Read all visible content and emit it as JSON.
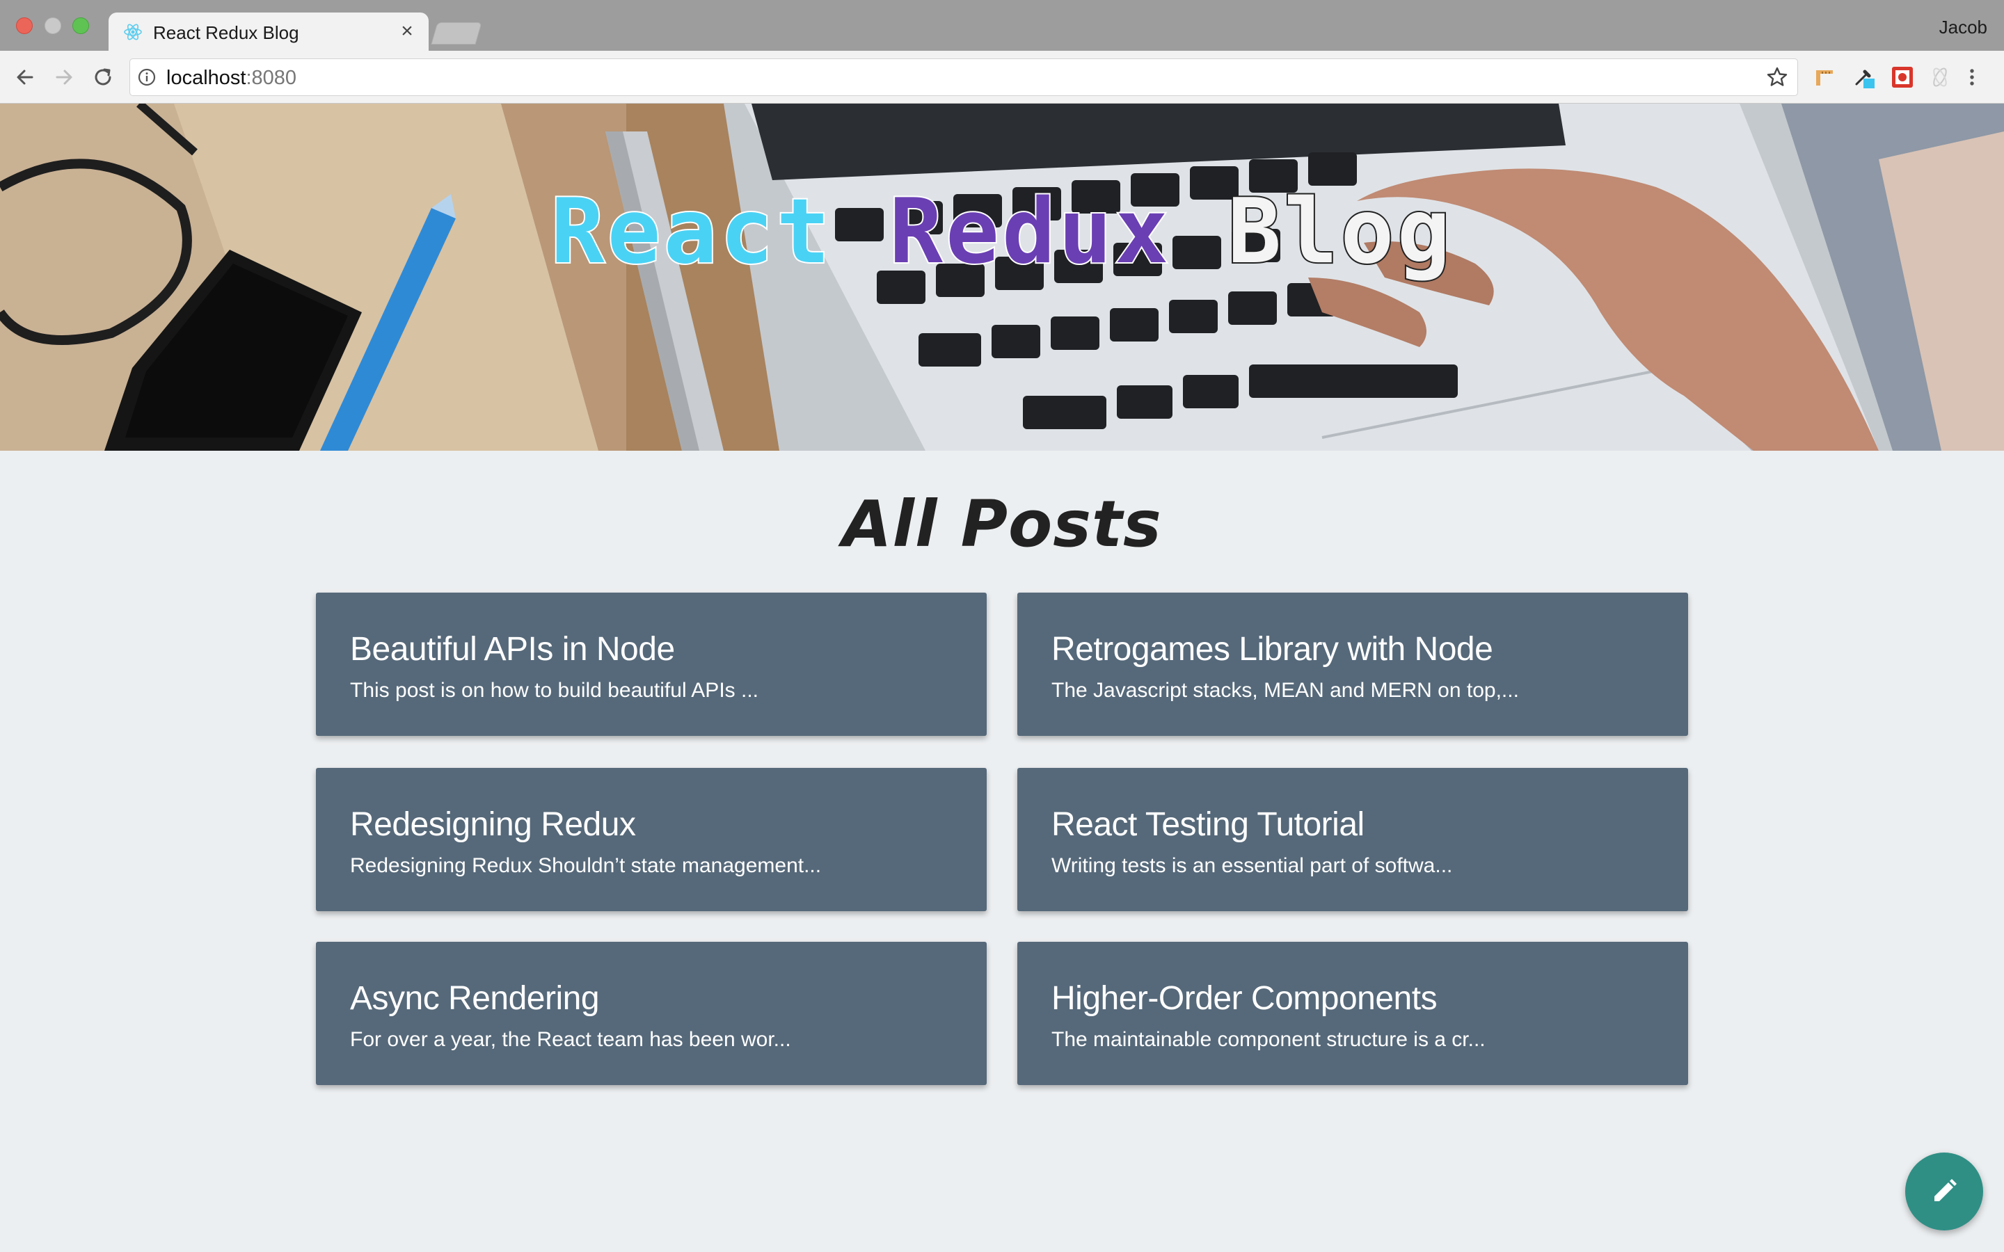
{
  "browser": {
    "tab_title": "React Redux Blog",
    "tab_close": "×",
    "profile_name": "Jacob",
    "url_host": "localhost",
    "url_port": ":8080"
  },
  "hero": {
    "title_word_1": "React",
    "title_word_2": "Redux",
    "title_word_3": "Blog"
  },
  "main": {
    "heading": "All Posts"
  },
  "posts": [
    {
      "title": "Beautiful APIs in Node",
      "excerpt": "This post is on how to build beautiful APIs ..."
    },
    {
      "title": "Retrogames Library with Node",
      "excerpt": "The Javascript stacks, MEAN and MERN on top,..."
    },
    {
      "title": "Redesigning Redux",
      "excerpt": "Redesigning Redux Shouldn’t state management..."
    },
    {
      "title": "React Testing Tutorial",
      "excerpt": "Writing tests is an essential part of softwa..."
    },
    {
      "title": "Async Rendering",
      "excerpt": "For over a year, the React team has been wor..."
    },
    {
      "title": "Higher-Order Components",
      "excerpt": "The maintainable component structure is a cr..."
    }
  ],
  "colors": {
    "card_bg": "#56697a",
    "fab_bg": "#2f8f85",
    "page_bg": "#eceff1",
    "react_cyan": "#4ad2f5",
    "redux_purple": "#6a3fb3"
  },
  "icons": {
    "fab": "pencil-icon",
    "tab_favicon": "react-logo-icon"
  }
}
